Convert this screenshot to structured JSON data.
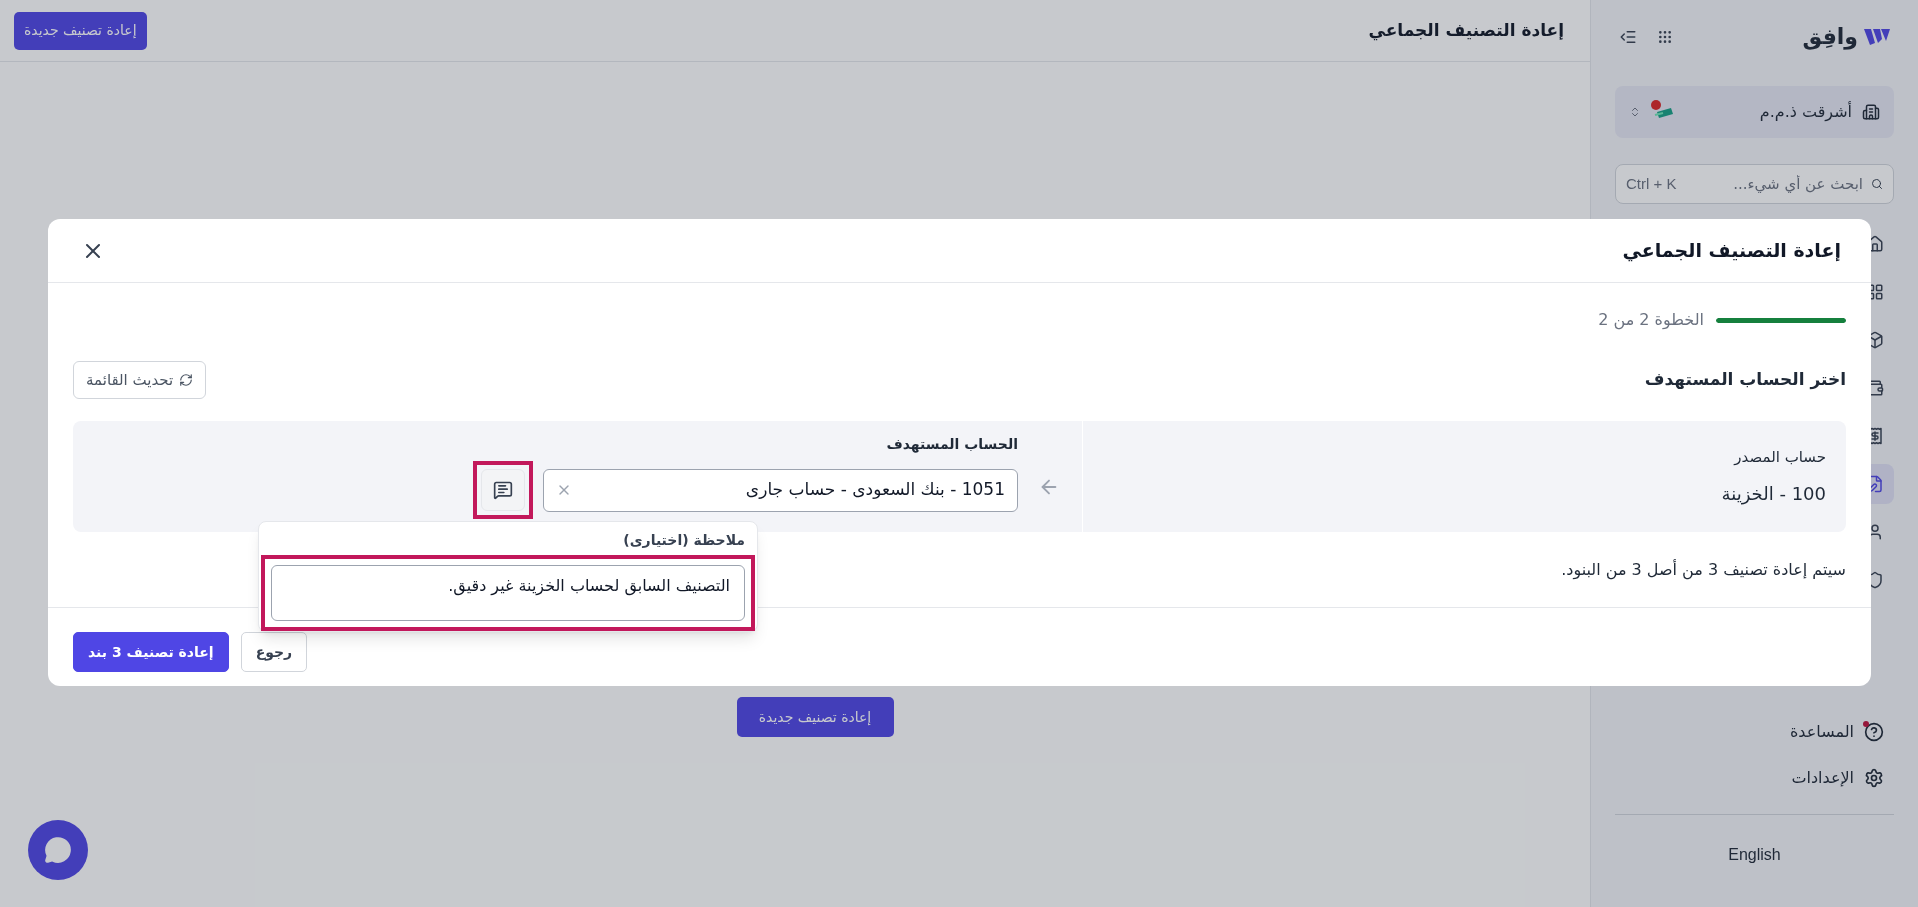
{
  "sidebar": {
    "logo_text": "وافِق",
    "company": {
      "name": "أشرقت ذ.م.م",
      "alert": true
    },
    "search": {
      "placeholder": "ابحث عن أي شيء...",
      "shortcut": "Ctrl + K"
    },
    "nav_items": [
      {
        "selected": false
      },
      {
        "selected": false
      },
      {
        "selected": false
      },
      {
        "selected": false
      },
      {
        "selected": false
      },
      {
        "selected": true
      },
      {
        "selected": false
      },
      {
        "selected": false
      }
    ],
    "footer_items": [
      {
        "kind": "help",
        "label": "المساعدة",
        "dot": true
      },
      {
        "kind": "settings",
        "label": "الإعدادات",
        "dot": false
      }
    ],
    "language": "English"
  },
  "page": {
    "title": "إعادة التصنيف الجماعي",
    "new_button": "إعادة تصنيف جديدة",
    "center_button": "إعادة تصنيف جديدة"
  },
  "modal": {
    "title": "إعادة التصنيف الجماعي",
    "step": {
      "label": "الخطوة 2 من 2",
      "level": 1
    },
    "heading": "اختر الحساب المستهدف",
    "refresh_button": "تحديث القائمة",
    "source": {
      "label": "حساب المصدر",
      "value": "100 - الخزينة"
    },
    "target": {
      "label": "الحساب المستهدف",
      "value": "1051 - بنك السعودى - حساب جارى",
      "note_highlighted": true
    },
    "note": {
      "label": "ملاحظة (اختيارى)",
      "value": "التصنيف السابق لحساب الخزينة غير دقيق.",
      "highlighted": true
    },
    "summary": "سيتم إعادة تصنيف 3 من أصل 3 من البنود.",
    "buttons": [
      {
        "kind": "secondary",
        "label": "رجوع"
      },
      {
        "kind": "primary",
        "label": "إعادة تصنيف 3 بند"
      }
    ]
  }
}
